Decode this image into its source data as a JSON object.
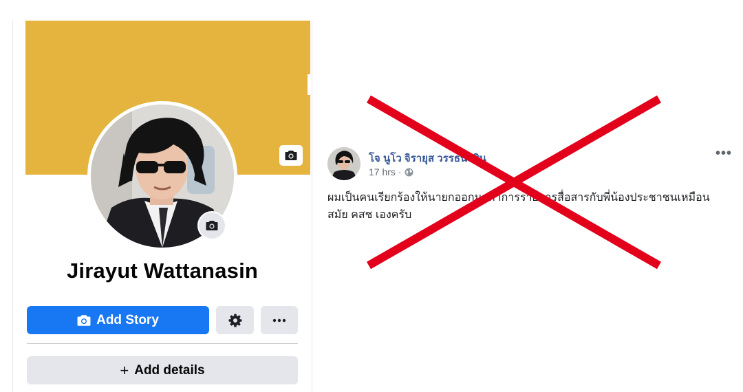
{
  "profile": {
    "name": "Jirayut Wattanasin",
    "cover_color": "#e5b43e",
    "buttons": {
      "add_story": "Add Story",
      "settings_icon": "gear-icon",
      "more_icon": "more-horizontal-icon",
      "add_details": "Add details"
    }
  },
  "post": {
    "author": "โจ นูโว จิรายุส วรรธนะสิน",
    "time": "17 hrs",
    "separator": "·",
    "privacy_icon": "globe-icon",
    "text": "ผมเป็นคนเรียกร้องให้นายกออกมาทำการรายการสื่อสารกับพี่น้องประชาชนเหมือนสมัย คสช เองครับ",
    "options_label": "•••"
  },
  "overlay": {
    "cross_color": "#e3001b"
  }
}
